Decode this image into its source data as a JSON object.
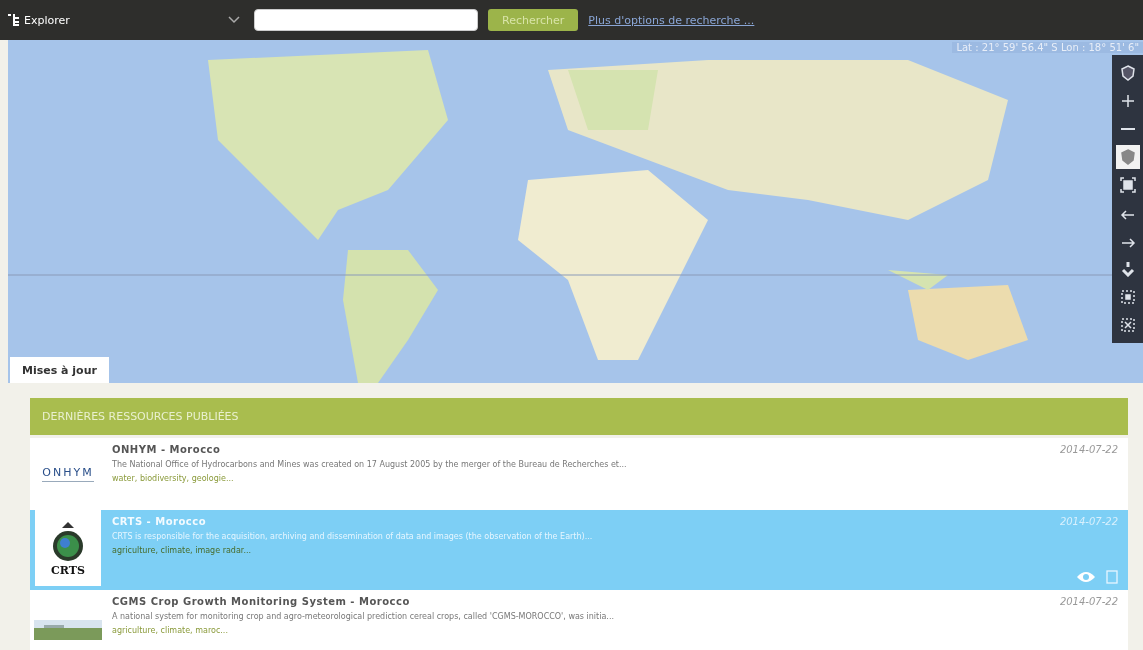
{
  "topbar": {
    "app_title": "Explorer",
    "search_button": "Rechercher",
    "more_link": "Plus d'options de recherche ..."
  },
  "map": {
    "coordinates": "Lat : 21° 59' 56.4\" S  Lon : 18° 51' 6\"",
    "tools": [
      {
        "kind": "globe",
        "selected": false
      },
      {
        "kind": "zoom-in",
        "selected": false
      },
      {
        "kind": "zoom-out",
        "selected": false
      },
      {
        "kind": "hand",
        "selected": true
      },
      {
        "kind": "extent",
        "selected": false
      },
      {
        "kind": "back",
        "selected": false
      },
      {
        "kind": "forward",
        "selected": false
      },
      {
        "kind": "pin",
        "selected": false
      },
      {
        "kind": "box-in",
        "selected": false
      },
      {
        "kind": "box-out",
        "selected": false
      }
    ]
  },
  "tab": {
    "label": "Mises à jour",
    "selected": true
  },
  "panel": {
    "header": "DERNIÈRES RESSOURCES PUBLIÉES",
    "items": [
      {
        "logo": {
          "kind": "text_logo",
          "text": "ONHYM"
        },
        "title": "ONHYM - Morocco",
        "description": "The National Office of Hydrocarbons and Mines was created on 17 August 2005 by the merger of the Bureau de Recherches et...",
        "tags": "water, biodiversity, geologie...",
        "date": "2014-07-22",
        "selected": false
      },
      {
        "logo": {
          "kind": "emblem",
          "text": "CRTS"
        },
        "title": "CRTS - Morocco",
        "description": "CRTS is responsible for the acquisition, archiving and dissemination of data and images (the observation of the Earth)...",
        "tags": "agriculture, climate, image radar...",
        "date": "2014-07-22",
        "selected": true
      },
      {
        "title": "CGMS Crop Growth Monitoring System - Morocco",
        "description": "A national system for monitoring crop and agro-meteorological prediction cereal crops, called 'CGMS-MOROCCO', was initia...",
        "tags": "agriculture, climate, maroc...",
        "date": "2014-07-22",
        "selected": false
      }
    ]
  }
}
